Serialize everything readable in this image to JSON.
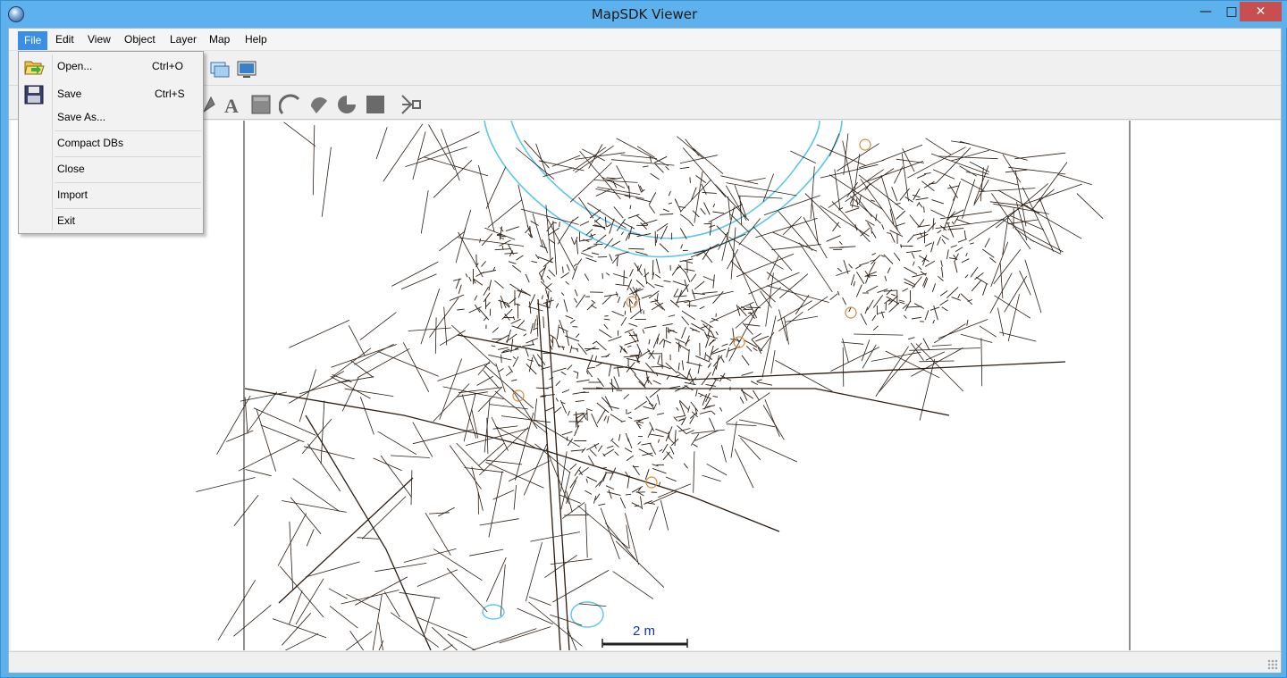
{
  "window": {
    "title": "MapSDK Viewer",
    "minimize_glyph": "—",
    "maximize_glyph": "□",
    "close_glyph": "✕"
  },
  "menubar": {
    "items": [
      {
        "label": "File",
        "active": true
      },
      {
        "label": "Edit"
      },
      {
        "label": "View"
      },
      {
        "label": "Object"
      },
      {
        "label": "Layer"
      },
      {
        "label": "Map"
      },
      {
        "label": "Help"
      }
    ]
  },
  "file_menu": {
    "items": [
      {
        "label": "Open...",
        "shortcut": "Ctrl+O",
        "icon": "folder-open-icon"
      },
      {
        "label": "Save",
        "shortcut": "Ctrl+S",
        "icon": "floppy-disk-icon"
      },
      {
        "label": "Save As..."
      },
      {
        "label": "Compact DBs"
      },
      {
        "label": "Close"
      },
      {
        "label": "Import"
      },
      {
        "label": "Exit"
      }
    ]
  },
  "toolbar1": {
    "icons": [
      "layers-icon",
      "monitor-icon"
    ]
  },
  "toolbar2": {
    "icons": [
      "text-tool-icon",
      "rectangle-tool-icon",
      "arc-tool-icon",
      "chord-tool-icon",
      "pie-tool-icon",
      "filled-rectangle-tool-icon",
      "snap-tool-icon"
    ]
  },
  "map": {
    "scale_label": "2 m",
    "colors": {
      "background": "#ffffff",
      "streets": "#2b1d12",
      "water": "#5ec6e8",
      "poi": "#d88a3a",
      "scale_bar": "#1f2fb0"
    }
  }
}
